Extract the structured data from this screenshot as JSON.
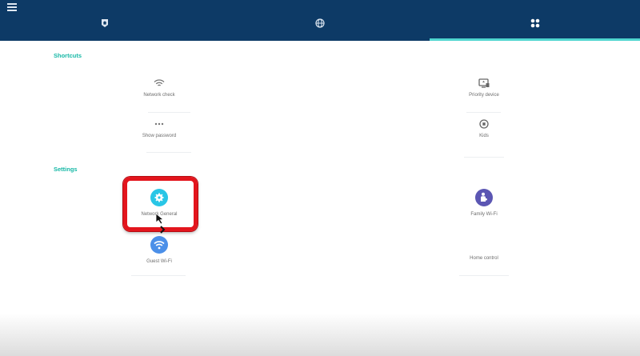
{
  "header": {
    "menu_icon": "hamburger-menu-icon",
    "tabs": [
      {
        "icon": "home-shield-icon",
        "active": false
      },
      {
        "icon": "globe-icon",
        "active": false
      },
      {
        "icon": "grid-apps-icon",
        "active": true
      }
    ],
    "colors": {
      "background": "#0d3a66",
      "indicator": "#4fd6cf"
    }
  },
  "shortcuts": {
    "title": "Shortcuts",
    "items": [
      {
        "label": "Network check",
        "icon": "wifi-signal-icon"
      },
      {
        "label": "Priority device",
        "icon": "priority-device-icon"
      },
      {
        "label": "Show password",
        "icon": "dots-password-icon"
      },
      {
        "label": "Kids",
        "icon": "kids-icon"
      }
    ]
  },
  "settings": {
    "title": "Settings",
    "items": [
      {
        "label": "Network General",
        "icon": "gear-icon",
        "color": "#29c6e6"
      },
      {
        "label": "Family Wi-Fi",
        "icon": "family-icon",
        "color": "#5b56b3"
      },
      {
        "label": "Guest Wi-Fi",
        "icon": "wifi-icon",
        "color": "#4b8fe8"
      },
      {
        "label": "Home control",
        "icon": "home-control-icon"
      }
    ]
  },
  "accent_colors": {
    "section_title": "#16b8a6",
    "highlight": "#e3151d"
  }
}
